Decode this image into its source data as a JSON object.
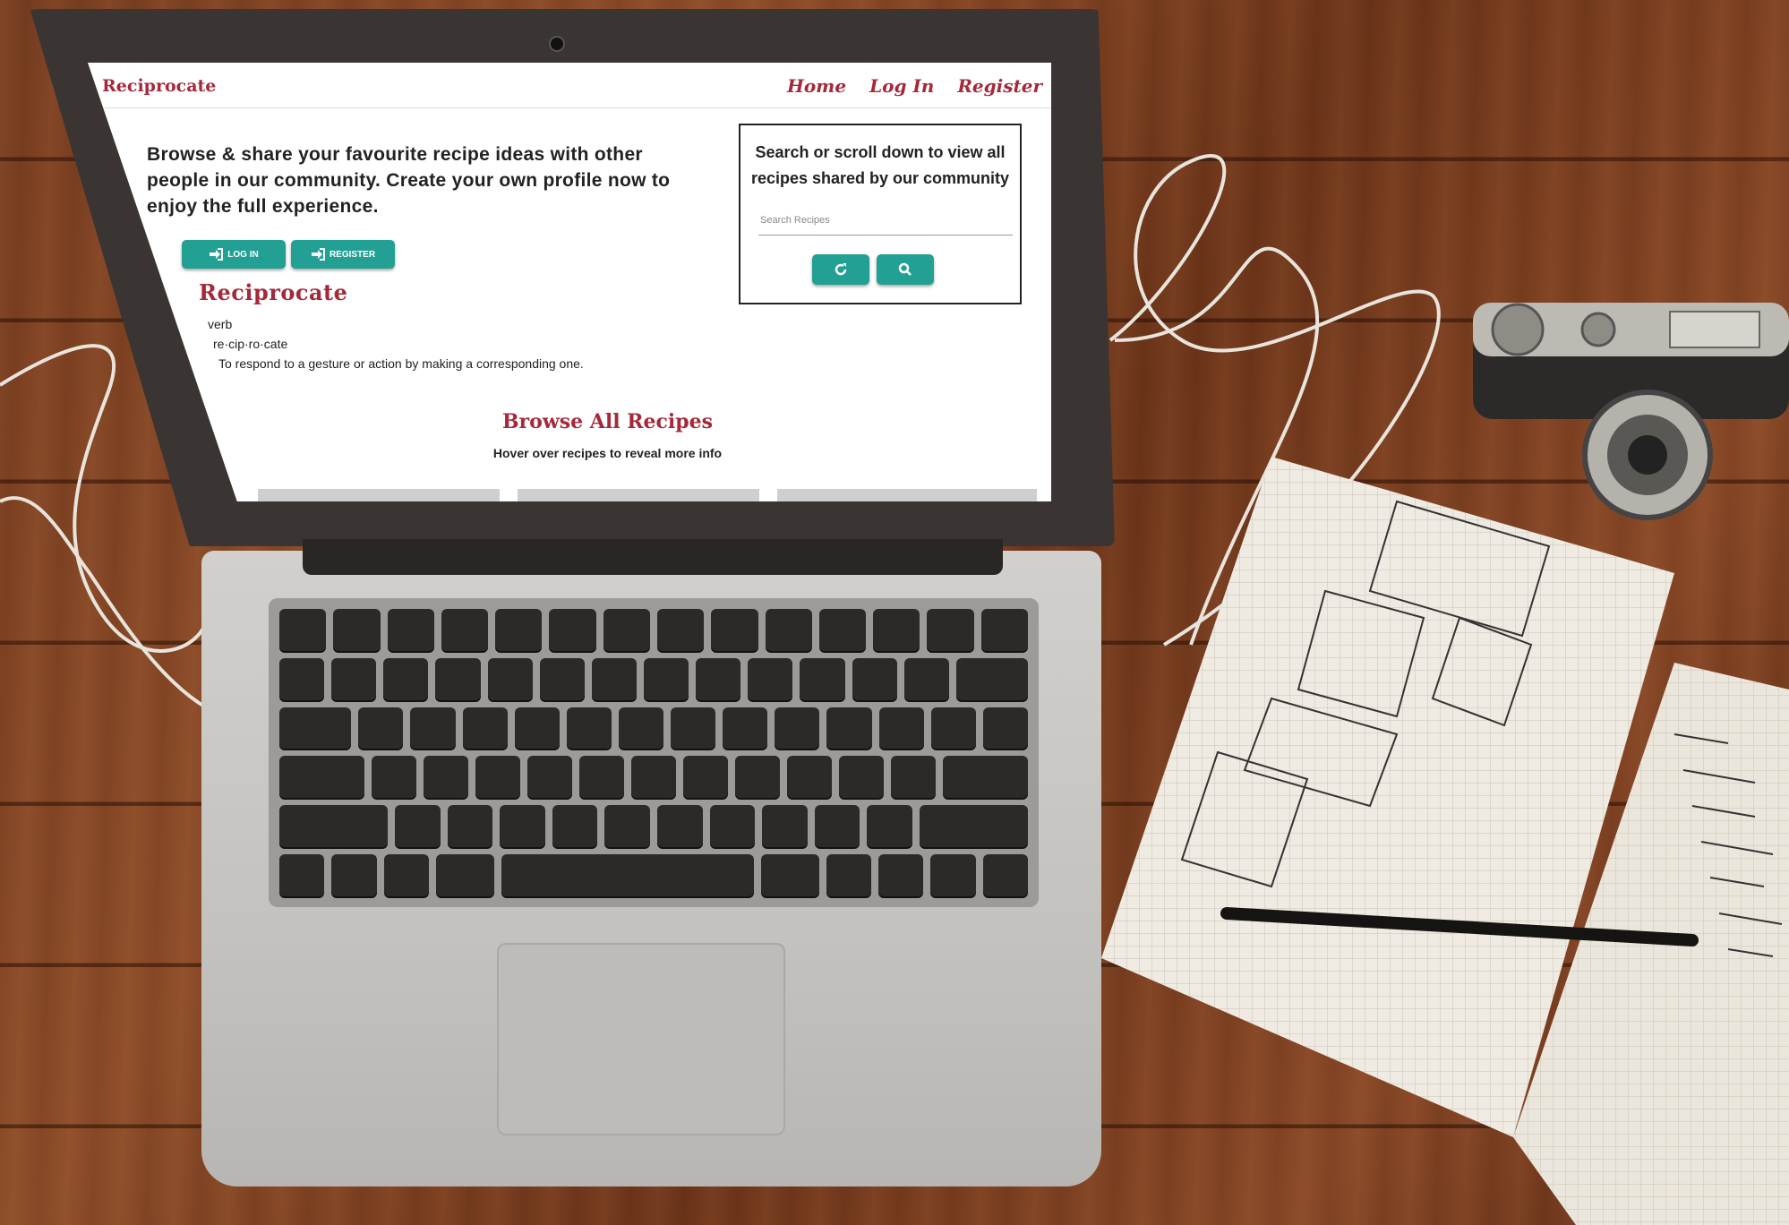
{
  "site": {
    "brand": "Reciprocate",
    "nav": [
      "Home",
      "Log In",
      "Register"
    ]
  },
  "intro": {
    "text": "Browse & share your favourite recipe ideas with other people in our community. Create your own profile now to enjoy the full experience.",
    "login_label": "LOG IN",
    "register_label": "REGISTER"
  },
  "definition": {
    "word": "Reciprocate",
    "pos": "verb",
    "syllables": "re·cip·ro·cate",
    "meaning": "To respond to a gesture or action by making a corresponding one."
  },
  "search": {
    "heading": "Search or scroll down to view all recipes shared by our community",
    "placeholder": "Search Recipes",
    "reset_icon": "refresh-icon",
    "submit_icon": "search-icon"
  },
  "browse": {
    "title": "Browse All Recipes",
    "hint": "Hover over recipes to reveal more info"
  },
  "colors": {
    "brand": "#a4293a",
    "button": "#22a093"
  }
}
